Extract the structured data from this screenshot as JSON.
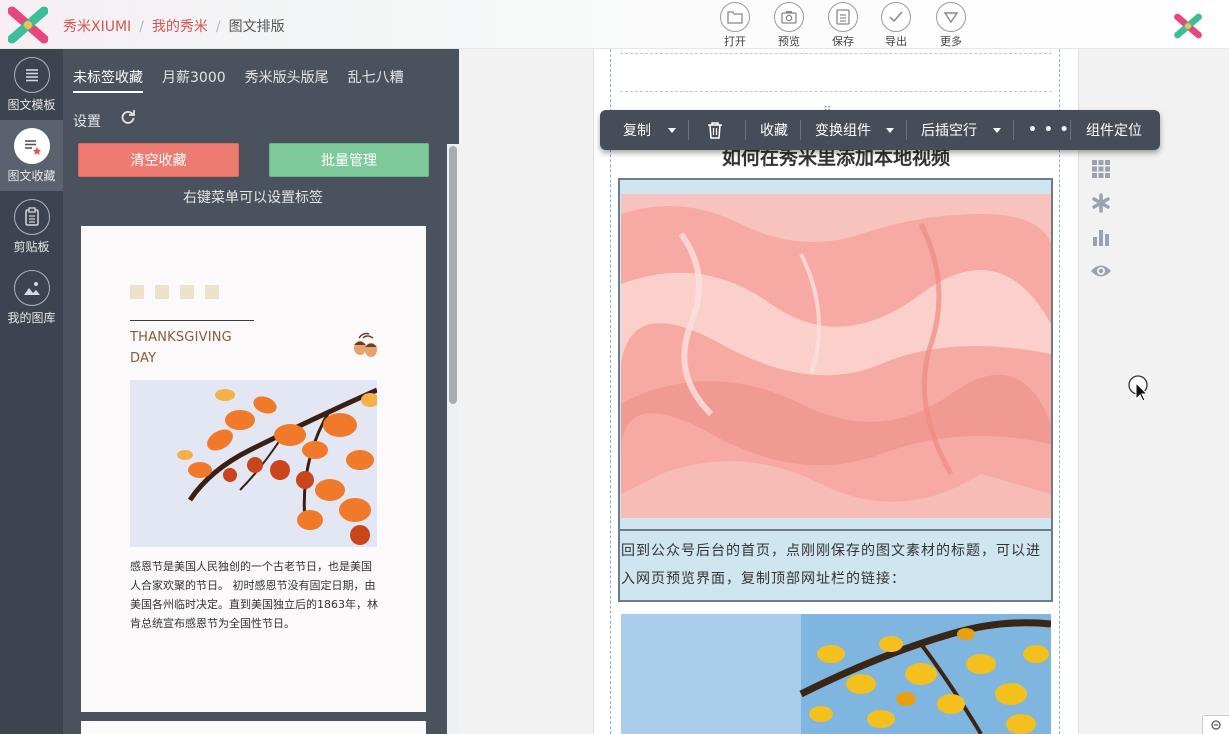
{
  "app": {
    "brand": "秀米XIUMI",
    "crumb_mine": "我的秀米",
    "crumb_current": "图文排版"
  },
  "toolbar_top": [
    {
      "label": "打开",
      "icon": "folder-open-icon"
    },
    {
      "label": "预览",
      "icon": "preview-icon"
    },
    {
      "label": "保存",
      "icon": "save-icon"
    },
    {
      "label": "导出",
      "icon": "export-check-icon"
    },
    {
      "label": "更多",
      "icon": "more-chevron-icon"
    }
  ],
  "leftnav": [
    {
      "label": "图文模板",
      "icon": "template-list-icon",
      "active": false
    },
    {
      "label": "图文收藏",
      "icon": "favorites-icon",
      "active": true
    },
    {
      "label": "剪贴板",
      "icon": "clipboard-icon",
      "active": false
    },
    {
      "label": "我的图库",
      "icon": "gallery-icon",
      "active": false
    }
  ],
  "panel": {
    "tabs": [
      "未标签收藏",
      "月薪3000",
      "秀米版头版尾",
      "乱七八糟"
    ],
    "settings": "设置",
    "clear_button": "清空收藏",
    "batch_button": "批量管理",
    "hint": "右键菜单可以设置标签",
    "card": {
      "title_line1": "THANKSGIVING",
      "title_line2": "DAY",
      "text": "感恩节是美国人民独创的一个古老节日，也是美国人合家欢聚的节日。 初时感恩节没有固定日期，由美国各州临时决定。直到美国独立后的1863年，林肯总统宣布感恩节为全国性节日。"
    }
  },
  "component_toolbar": {
    "copy": "复制",
    "favorite": "收藏",
    "switch": "变换组件",
    "insert_after": "后插空行",
    "more": "• • •",
    "locate": "组件定位"
  },
  "article": {
    "title": "如何在秀米里添加本地视频",
    "paragraph": "回到公众号后台的首页，点刚刚保存的图文素材的标题，可以进入网页预览界面，复制顶部网址栏的链接："
  },
  "colors": {
    "brand_red": "#d9534f",
    "nav_dark": "#3c4450",
    "panel": "#4a525e",
    "clear_red": "#ee7b72",
    "batch_green": "#7ec999",
    "block_blue": "#cfe5ef"
  }
}
